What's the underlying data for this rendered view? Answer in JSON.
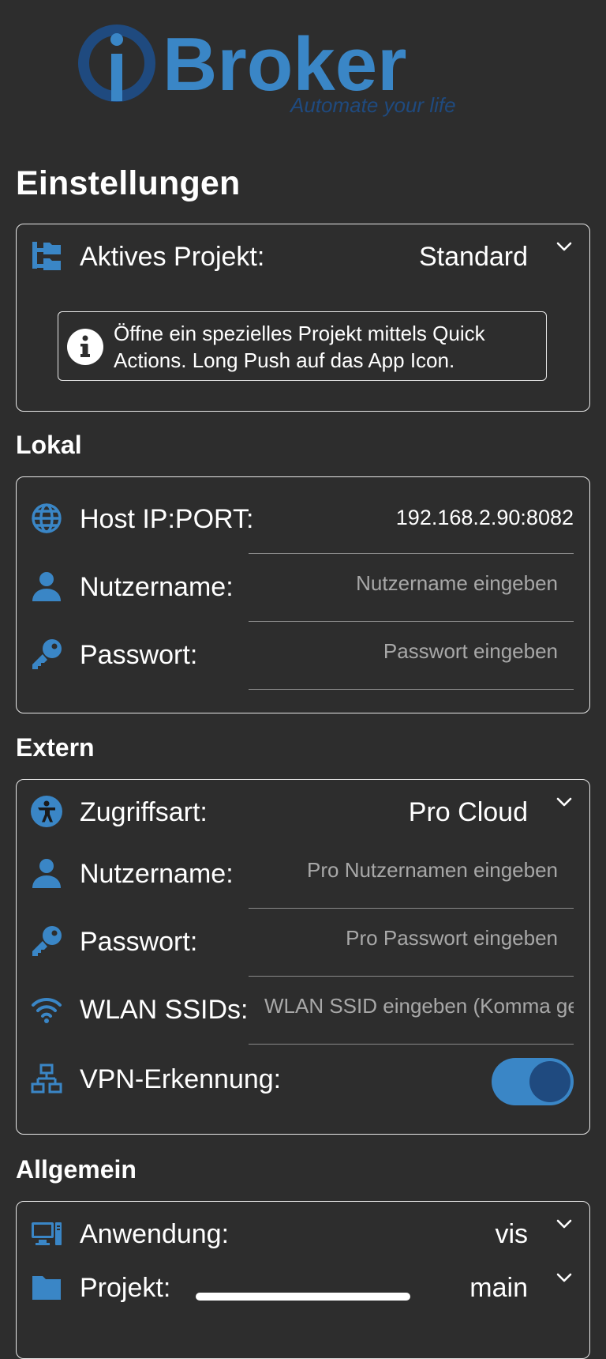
{
  "colors": {
    "background": "#2d2d2d",
    "accent": "#3a86c6",
    "logo_dark": "#1f4a7f",
    "logo_light": "#3a86c6"
  },
  "logo": {
    "brand": "Broker",
    "tagline": "Automate your life"
  },
  "page_title": "Einstellungen",
  "project": {
    "icon": "folder-tree-icon",
    "label": "Aktives Projekt:",
    "value": "Standard",
    "info_icon": "info-icon",
    "info_text": "Öffne ein spezielles Projekt mittels Quick Actions. Long Push auf das App Icon."
  },
  "lokal": {
    "title": "Lokal",
    "host": {
      "icon": "globe-icon",
      "label": "Host IP:PORT:",
      "value": "192.168.2.90:8082"
    },
    "user": {
      "icon": "user-icon",
      "label": "Nutzername:",
      "placeholder": "Nutzername eingeben"
    },
    "password": {
      "icon": "key-icon",
      "label": "Passwort:",
      "placeholder": "Passwort eingeben"
    }
  },
  "extern": {
    "title": "Extern",
    "access": {
      "icon": "accessibility-icon",
      "label": "Zugriffsart:",
      "value": "Pro Cloud"
    },
    "user": {
      "icon": "user-icon",
      "label": "Nutzername:",
      "placeholder": "Pro Nutzernamen eingeben"
    },
    "password": {
      "icon": "key-icon",
      "label": "Passwort:",
      "placeholder": "Pro Passwort eingeben"
    },
    "ssid": {
      "icon": "wifi-icon",
      "label": "WLAN SSIDs:",
      "placeholder": "WLAN SSID eingeben (Komma getrennt)"
    },
    "vpn": {
      "icon": "network-icon",
      "label": "VPN-Erkennung:",
      "enabled": true
    }
  },
  "allgemein": {
    "title": "Allgemein",
    "app": {
      "icon": "desktop-icon",
      "label": "Anwendung:",
      "value": "vis"
    },
    "project": {
      "icon": "folder-icon",
      "label": "Projekt:",
      "value": "main"
    }
  }
}
